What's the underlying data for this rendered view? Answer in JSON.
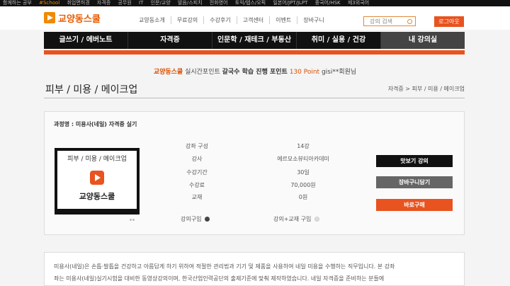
{
  "topbar": {
    "items": [
      "함께하는 공부",
      "#School",
      "취업면허경",
      "자격증",
      "공무원",
      "IT",
      "인문/교양",
      "발음/스피치",
      "전화영어",
      "토익/텝스/오픽",
      "일본어/JPT/JLPT",
      "중국어/HSK",
      "제3외국어"
    ]
  },
  "header": {
    "logo_text": "교양동스쿨",
    "nav": [
      "교양동소개",
      "무료강의",
      "수강후기",
      "고객센터",
      "이벤트",
      "장바구니"
    ],
    "search_placeholder": "강의 검색",
    "logout_label": "로그아웃"
  },
  "mainnav": [
    "글쓰기 / 에버노트",
    "자격증",
    "인문학 / 재테크 / 부동산",
    "취미 / 실용 / 건강",
    "내 강의실"
  ],
  "points": {
    "brand": "교양동스쿨",
    "text1": " 실시간포인트 ",
    "highlight": "갈국수 학습 진행 포인트",
    "value": " 130 Point",
    "user": " gisi**회원님"
  },
  "page": {
    "title": "피부 / 미용 / 메이크업",
    "breadcrumb": "자격증 > 피부 / 미용 / 메이크업"
  },
  "course": {
    "name": "과정명 : 미용사(네일) 자격증 실기",
    "thumb_category": "피부 / 미용 / 메이크업",
    "thumb_brand": "교양동스쿨",
    "rows": [
      {
        "label": "강좌 구성",
        "value": "14강"
      },
      {
        "label": "강사",
        "value": "에르모소뷰티아카데미"
      },
      {
        "label": "수강기간",
        "value": "30일"
      },
      {
        "label": "수강료",
        "value": "70,000원"
      },
      {
        "label": "교재",
        "value": "0원"
      }
    ],
    "option_lecture": "강의구입",
    "option_lecture_book": "강의+교재 구입",
    "btn_watch": "맛보기 강의",
    "btn_cart": "장바구니담기",
    "btn_buy": "바로구매"
  },
  "description": {
    "line1": "미용사(네일)은 손톱·발톱을 건강하고 아름답게 하기 위하여 적절한 관리법과 기기 및 제품을 사용하여 네일 미용을 수행하는 직무입니다. 본 강좌",
    "line2": "좌는 미용사(네일)실기시험을 대비한 동영상강의이며, 한국산업인력공단의 출제기준에 맞춰 제작하였습니다. 네일 자격증을 준비하는 분들에"
  }
}
